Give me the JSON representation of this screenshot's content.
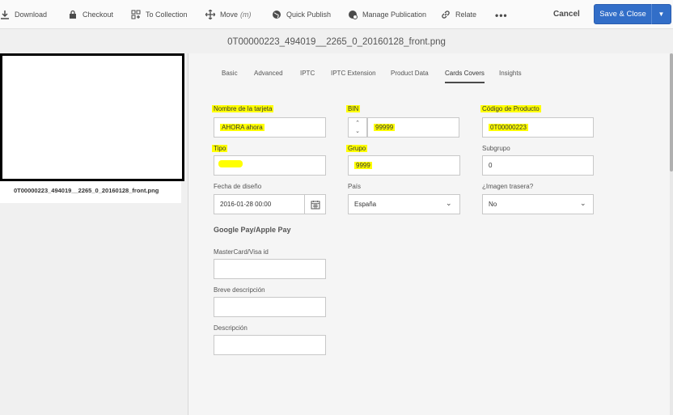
{
  "toolbar": {
    "download": "Download",
    "checkout": "Checkout",
    "to_collection": "To Collection",
    "move": "Move",
    "move_shortcut": "(m)",
    "quick_publish": "Quick Publish",
    "manage_publication": "Manage Publication",
    "relate": "Relate",
    "more": "•••",
    "cancel": "Cancel",
    "save_close": "Save & Close"
  },
  "asset": {
    "title": "0T00000223_494019__2265_0_20160128_front.png",
    "caption": "0T00000223_494019__2265_0_20160128_front.png"
  },
  "tabs": [
    "Basic",
    "Advanced",
    "IPTC",
    "IPTC Extension",
    "Product Data",
    "Cards Covers",
    "Insights"
  ],
  "active_tab": "Cards Covers",
  "form": {
    "nombre_label": "Nombre de la tarjeta",
    "nombre_value": "AHORA ahora",
    "bin_label": "BIN",
    "bin_value": "99999",
    "codigo_label": "Código de Producto",
    "codigo_value": "0T00000223",
    "tipo_label": "Tipo",
    "tipo_value": "",
    "grupo_label": "Grupo",
    "grupo_value": "9999",
    "subgrupo_label": "Subgrupo",
    "subgrupo_value": "0",
    "fecha_label": "Fecha de diseño",
    "fecha_value": "2016-01-28 00:00",
    "pais_label": "País",
    "pais_value": "España",
    "imagen_label": "¿Imagen trasera?",
    "imagen_value": "No",
    "section_title": "Google Pay/Apple Pay",
    "mastercard_label": "MasterCard/Visa id",
    "mastercard_value": "",
    "breve_label": "Breve descripción",
    "breve_value": "",
    "descripcion_label": "Descripción",
    "descripcion_value": ""
  },
  "colors": {
    "highlight": "#ffff00",
    "primary_button": "#326ec8"
  }
}
